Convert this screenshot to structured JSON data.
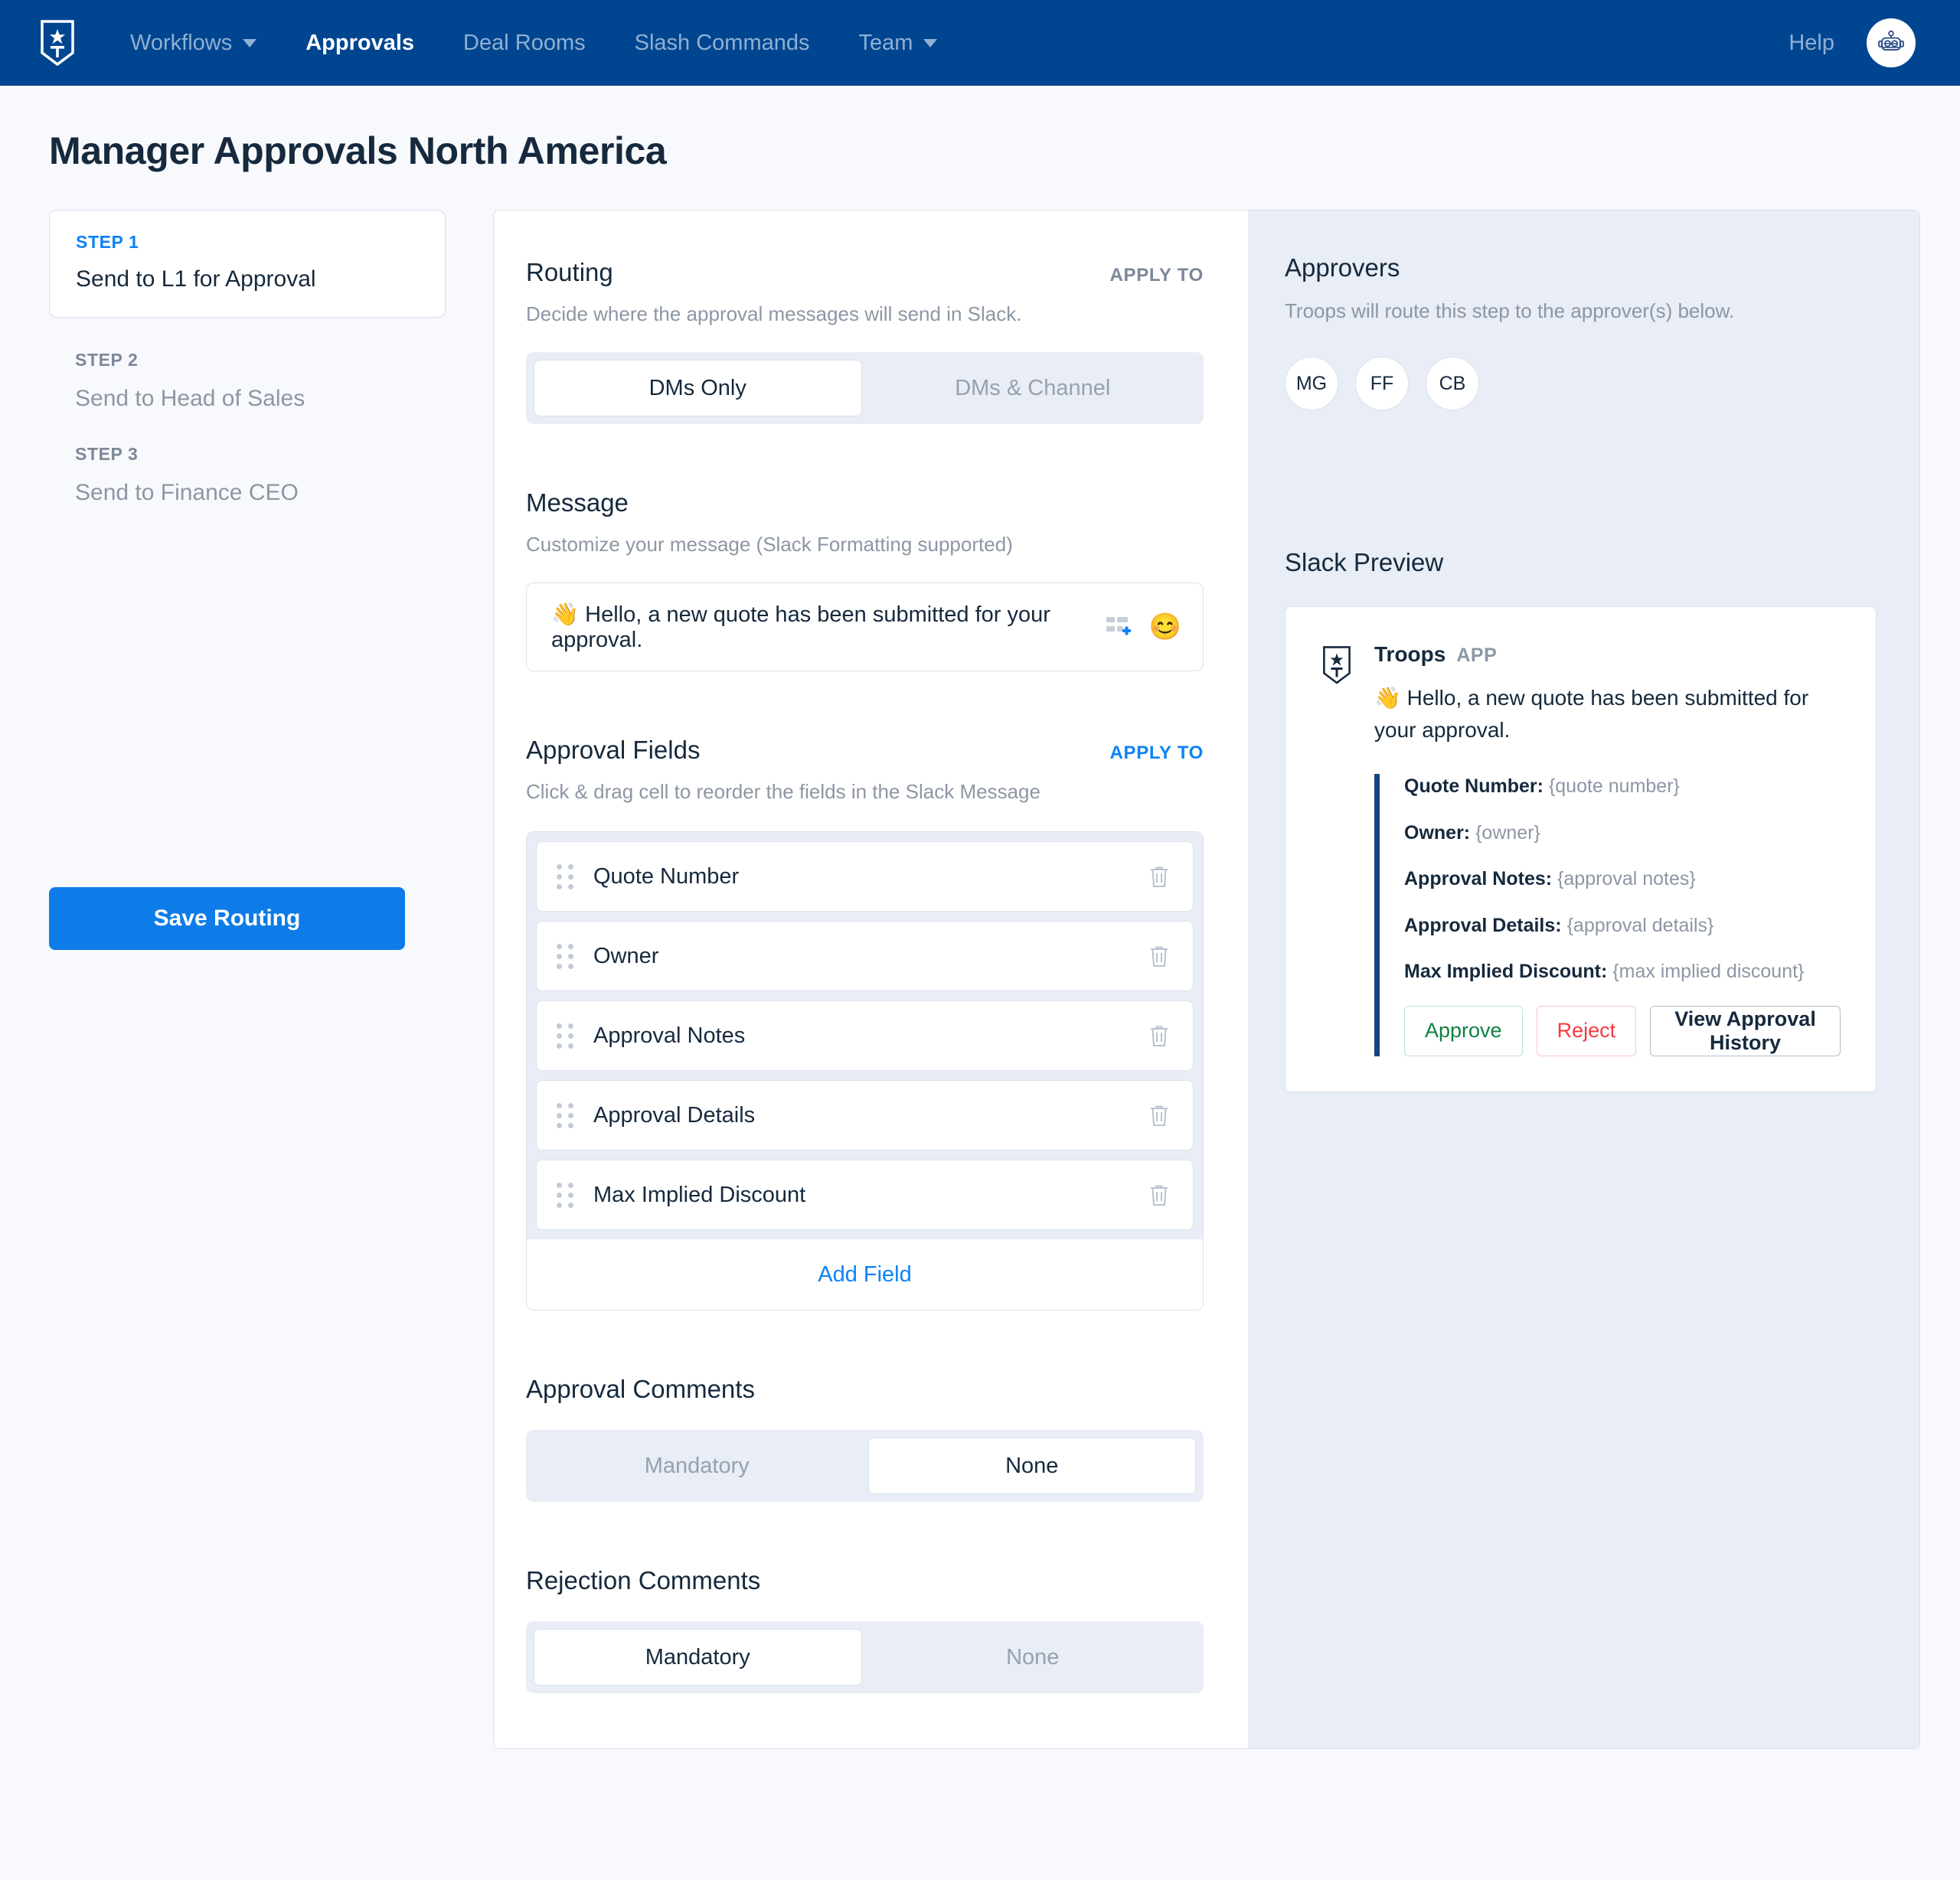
{
  "nav": {
    "logo_icon": "troops-shield-logo",
    "links": [
      {
        "label": "Workflows",
        "has_caret": true,
        "active": false
      },
      {
        "label": "Approvals",
        "has_caret": false,
        "active": true
      },
      {
        "label": "Deal Rooms",
        "has_caret": false,
        "active": false
      },
      {
        "label": "Slash Commands",
        "has_caret": false,
        "active": false
      },
      {
        "label": "Team",
        "has_caret": true,
        "active": false
      }
    ],
    "help_label": "Help",
    "avatar_icon": "robot-avatar-icon"
  },
  "page": {
    "title": "Manager Approvals North America"
  },
  "steps": [
    {
      "label": "STEP 1",
      "name": "Send to L1 for Approval",
      "active": true
    },
    {
      "label": "STEP 2",
      "name": "Send to Head of Sales",
      "active": false
    },
    {
      "label": "STEP 3",
      "name": "Send to Finance CEO",
      "active": false
    }
  ],
  "save_button": "Save Routing",
  "routing": {
    "title": "Routing",
    "apply_to": "APPLY TO",
    "subtitle": "Decide where the approval messages will send in Slack.",
    "options": [
      {
        "label": "DMs Only",
        "selected": true
      },
      {
        "label": "DMs & Channel",
        "selected": false
      }
    ]
  },
  "message": {
    "title": "Message",
    "subtitle": "Customize your message (Slack Formatting supported)",
    "value": "👋 Hello, a new quote has been submitted for your approval.",
    "insert_field_icon": "insert-field-icon",
    "emoji_icon": "emoji-picker-icon",
    "emoji_glyph": "😊"
  },
  "approval_fields": {
    "title": "Approval Fields",
    "apply_to": "APPLY TO",
    "subtitle": "Click & drag cell to reorder the fields in the Slack Message",
    "fields": [
      "Quote Number",
      "Owner",
      "Approval Notes",
      "Approval Details",
      "Max Implied Discount"
    ],
    "add_field_label": "Add Field"
  },
  "approval_comments": {
    "title": "Approval Comments",
    "options": [
      {
        "label": "Mandatory",
        "selected": false
      },
      {
        "label": "None",
        "selected": true
      }
    ]
  },
  "rejection_comments": {
    "title": "Rejection Comments",
    "options": [
      {
        "label": "Mandatory",
        "selected": true
      },
      {
        "label": "None",
        "selected": false
      }
    ]
  },
  "approvers": {
    "title": "Approvers",
    "subtitle": "Troops will route this step to the approver(s) below.",
    "people": [
      "MG",
      "FF",
      "CB"
    ]
  },
  "slack_preview": {
    "title": "Slack Preview",
    "app_name": "Troops",
    "app_tag": "APP",
    "message": "👋 Hello, a new quote has been submitted for your approval.",
    "fields": [
      {
        "label": "Quote Number:",
        "value": "{quote number}"
      },
      {
        "label": "Owner:",
        "value": "{owner}"
      },
      {
        "label": "Approval Notes:",
        "value": "{approval notes}"
      },
      {
        "label": "Approval Details:",
        "value": "{approval details}"
      },
      {
        "label": "Max Implied Discount:",
        "value": "{max implied discount}"
      }
    ],
    "actions": [
      {
        "label": "Approve",
        "style": "approve"
      },
      {
        "label": "Reject",
        "style": "reject"
      },
      {
        "label": "View Approval History",
        "style": "history"
      }
    ]
  },
  "colors": {
    "nav_blue": "#00458f",
    "accent_blue": "#0d82f5",
    "save_blue": "#0d7ce8",
    "panel_bg": "#e8edf6",
    "page_bg": "#f7f9fc",
    "text_dark": "#16293d",
    "text_muted": "#8d96a5",
    "approve_green": "#0f8043",
    "reject_red": "#f5393d",
    "slack_bar": "#13457e"
  }
}
